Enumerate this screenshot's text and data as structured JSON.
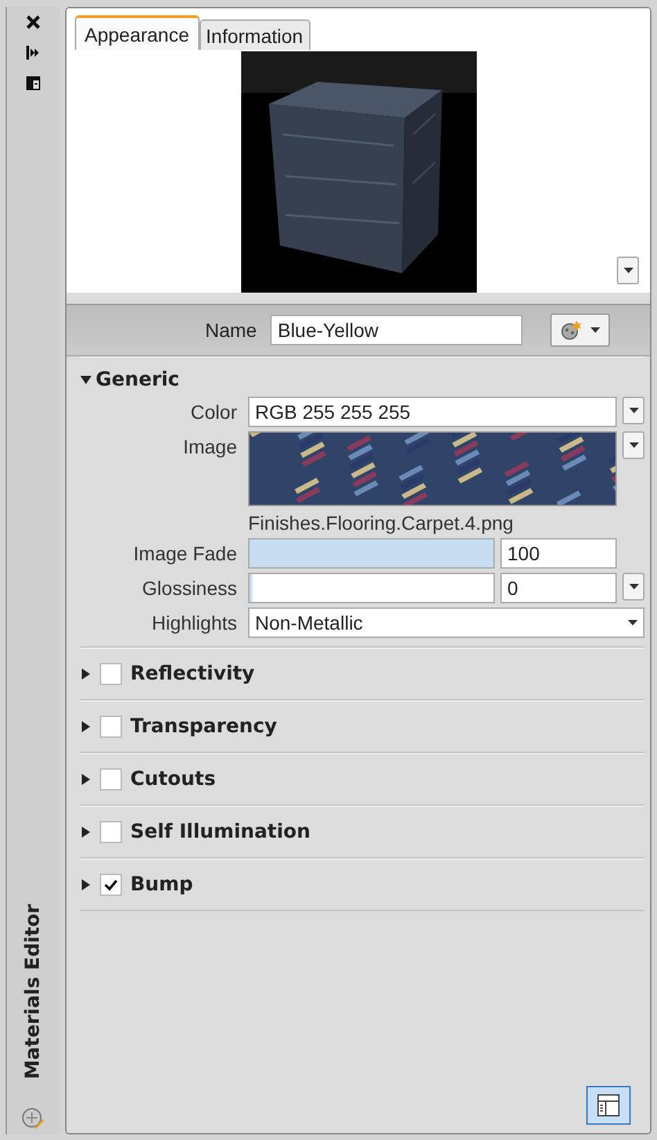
{
  "palette": {
    "title": "Materials Editor"
  },
  "tabs": [
    {
      "label": "Appearance",
      "selected": true
    },
    {
      "label": "Information",
      "selected": false
    }
  ],
  "name_field": {
    "label": "Name",
    "value": "Blue-Yellow"
  },
  "generic": {
    "title": "Generic",
    "expanded": true,
    "properties": [
      {
        "kind": "dropdown",
        "label": "Color",
        "value": "RGB 255 255 255"
      },
      {
        "label": "Image",
        "caption": "Finishes.Flooring.Carpet.4.png"
      },
      {
        "kind": "slider",
        "label": "Image Fade",
        "level": 1,
        "value": "100"
      },
      {
        "kind": "slider-dropdown",
        "label": "Glossiness",
        "level": 0,
        "value": "0"
      },
      {
        "kind": "select",
        "label": "Highlights",
        "value": "Non-Metallic"
      }
    ]
  },
  "sections": [
    {
      "title": "Reflectivity",
      "expanded": false,
      "checked": false
    },
    {
      "title": "Transparency",
      "expanded": false,
      "checked": false
    },
    {
      "title": "Cutouts",
      "expanded": false,
      "checked": false
    },
    {
      "title": "Self Illumination",
      "expanded": false,
      "checked": false
    },
    {
      "title": "Bump",
      "expanded": false,
      "checked": true
    }
  ]
}
